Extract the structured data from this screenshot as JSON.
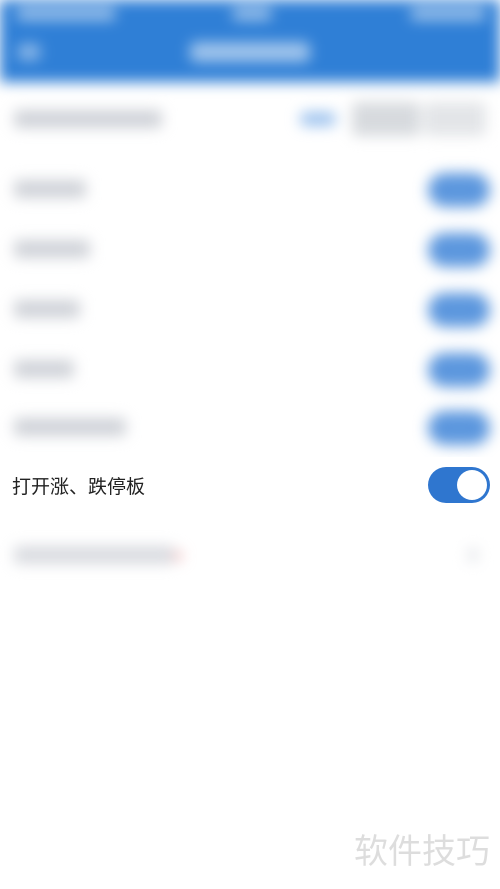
{
  "colors": {
    "header_blue": "#2f7fd6",
    "toggle_on": "#2f76cf",
    "knob": "#ffffff"
  },
  "settings": {
    "limit_board": {
      "label": "打开涨、跌停板",
      "enabled": true
    }
  },
  "watermark": {
    "text": "软件技巧"
  }
}
